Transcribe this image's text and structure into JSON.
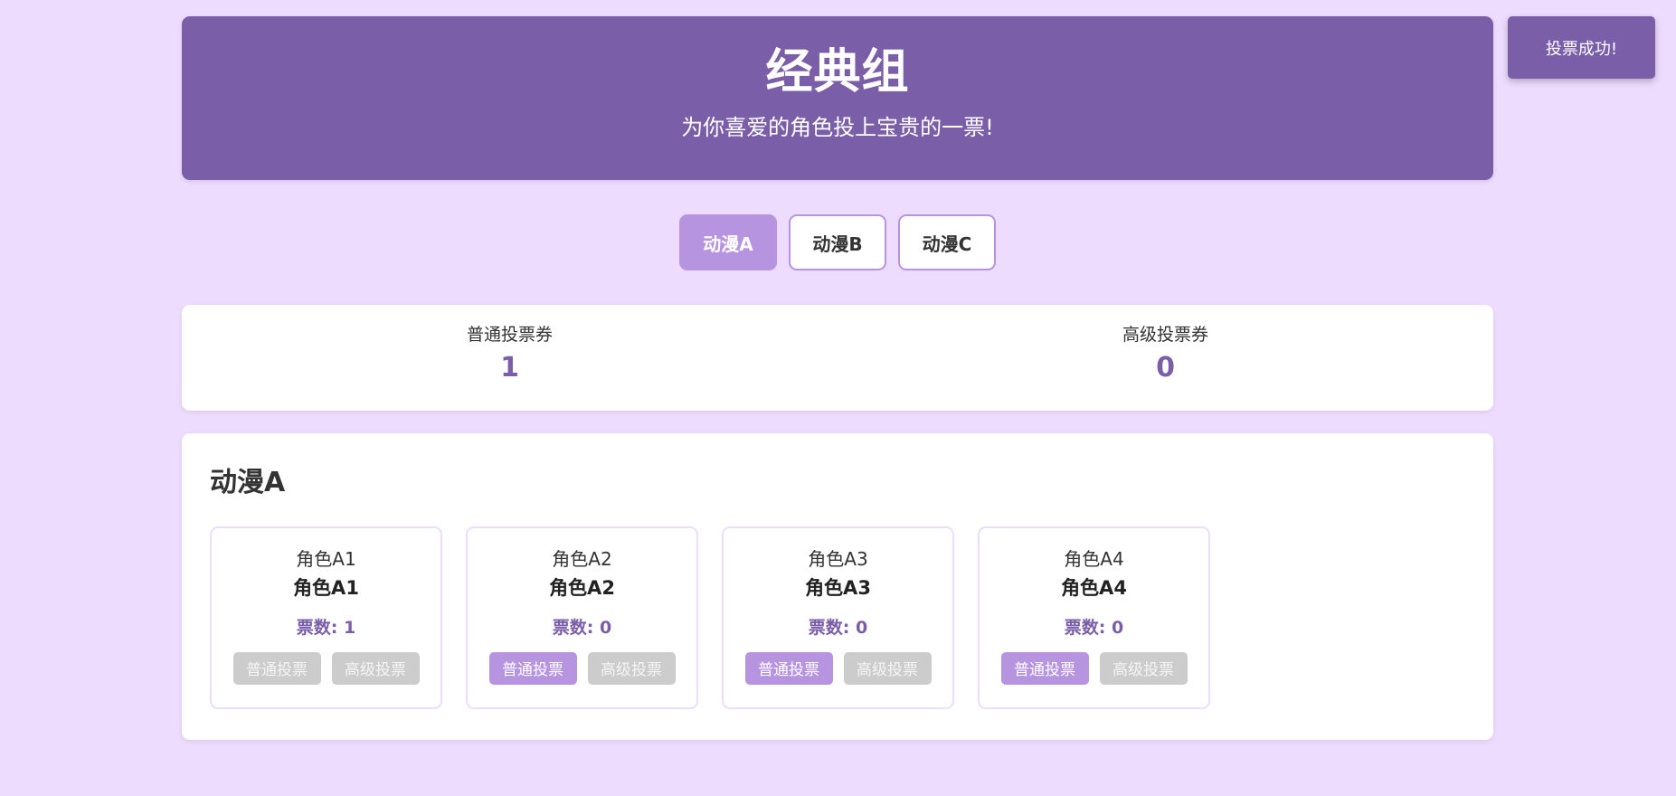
{
  "header": {
    "title": "经典组",
    "subtitle": "为你喜爱的角色投上宝贵的一票!"
  },
  "tabs": [
    {
      "label": "动漫A",
      "active": true
    },
    {
      "label": "动漫B",
      "active": false
    },
    {
      "label": "动漫C",
      "active": false
    }
  ],
  "tickets": {
    "normal": {
      "label": "普通投票券",
      "value": "1"
    },
    "premium": {
      "label": "高级投票券",
      "value": "0"
    }
  },
  "anime": {
    "title": "动漫A",
    "characters": [
      {
        "top_label": "角色A1",
        "name": "角色A1",
        "votes_text": "票数: 1",
        "normal_vote_label": "普通投票",
        "premium_vote_label": "高级投票",
        "normal_enabled": false,
        "premium_enabled": false
      },
      {
        "top_label": "角色A2",
        "name": "角色A2",
        "votes_text": "票数: 0",
        "normal_vote_label": "普通投票",
        "premium_vote_label": "高级投票",
        "normal_enabled": true,
        "premium_enabled": false
      },
      {
        "top_label": "角色A3",
        "name": "角色A3",
        "votes_text": "票数: 0",
        "normal_vote_label": "普通投票",
        "premium_vote_label": "高级投票",
        "normal_enabled": true,
        "premium_enabled": false
      },
      {
        "top_label": "角色A4",
        "name": "角色A4",
        "votes_text": "票数: 0",
        "normal_vote_label": "普通投票",
        "premium_vote_label": "高级投票",
        "normal_enabled": true,
        "premium_enabled": false
      }
    ]
  },
  "toast": {
    "message": "投票成功!"
  },
  "colors": {
    "background": "#eedcff",
    "primary": "#7b5ea8",
    "accent": "#b794e0",
    "disabled": "#cccccc"
  }
}
